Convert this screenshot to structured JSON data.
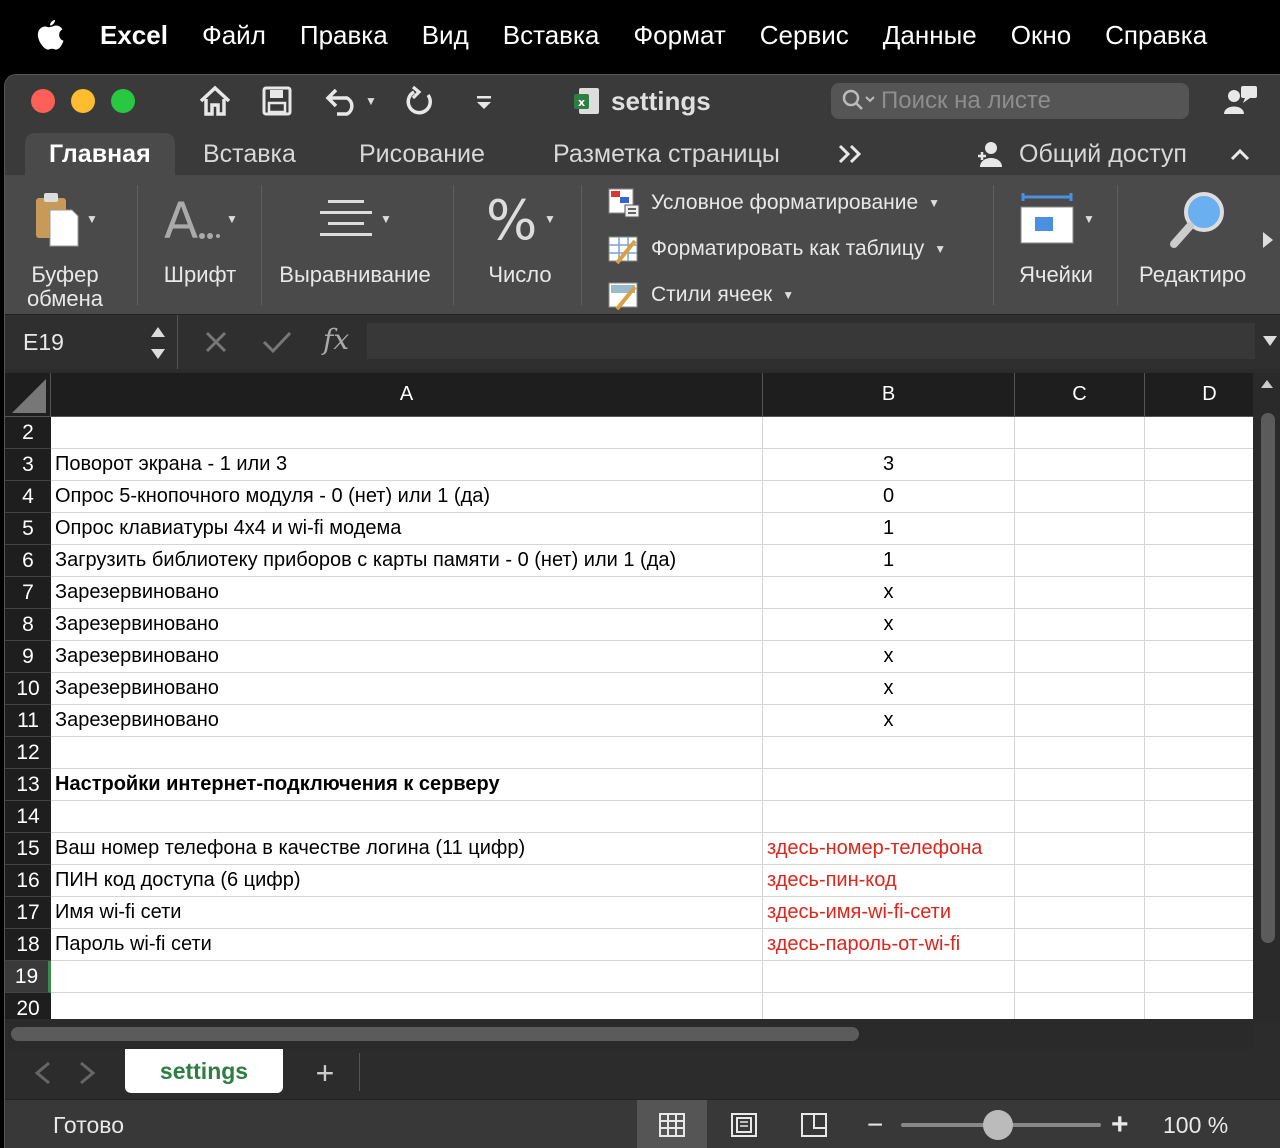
{
  "menubar": {
    "app": "Excel",
    "items": [
      "Файл",
      "Правка",
      "Вид",
      "Вставка",
      "Формат",
      "Сервис",
      "Данные",
      "Окно",
      "Справка"
    ]
  },
  "titlebar": {
    "doc_title": "settings",
    "search_placeholder": "Поиск на листе"
  },
  "ribbon_tabs": {
    "items": [
      "Главная",
      "Вставка",
      "Рисование",
      "Разметка страницы"
    ],
    "more": "»",
    "share": "Общий доступ"
  },
  "ribbon": {
    "clipboard_line1": "Буфер",
    "clipboard_line2": "обмена",
    "font": "Шрифт",
    "alignment": "Выравнивание",
    "number": "Число",
    "conditional_formatting": "Условное форматирование",
    "format_as_table": "Форматировать как таблицу",
    "cell_styles": "Стили ячеек",
    "cells": "Ячейки",
    "editing": "Редактиро"
  },
  "formula_bar": {
    "name_box": "E19",
    "fx": "fx",
    "value": ""
  },
  "grid": {
    "columns": [
      "A",
      "B",
      "C",
      "D"
    ],
    "rows": [
      {
        "num": "2",
        "a": "",
        "b": ""
      },
      {
        "num": "3",
        "a": "Поворот экрана - 1 или 3",
        "b": "3"
      },
      {
        "num": "4",
        "a": "Опрос 5-кнопочного модуля - 0 (нет) или 1 (да)",
        "b": "0"
      },
      {
        "num": "5",
        "a": "Опрос клавиатуры 4x4 и wi-fi модема",
        "b": "1"
      },
      {
        "num": "6",
        "a": "Загрузить библиотеку приборов с карты памяти - 0 (нет) или 1 (да)",
        "b": "1"
      },
      {
        "num": "7",
        "a": "Зарезервиновано",
        "b": "x"
      },
      {
        "num": "8",
        "a": "Зарезервиновано",
        "b": "x"
      },
      {
        "num": "9",
        "a": "Зарезервиновано",
        "b": "x"
      },
      {
        "num": "10",
        "a": "Зарезервиновано",
        "b": "x"
      },
      {
        "num": "11",
        "a": "Зарезервиновано",
        "b": "x"
      },
      {
        "num": "12",
        "a": "",
        "b": ""
      },
      {
        "num": "13",
        "a": "Настройки интернет-подключения к серверу",
        "b": ""
      },
      {
        "num": "14",
        "a": "",
        "b": ""
      },
      {
        "num": "15",
        "a": "Ваш номер телефона в качестве логина (11 цифр)",
        "b": "здесь-номер-телефона"
      },
      {
        "num": "16",
        "a": "ПИН код доступа (6 цифр)",
        "b": "здесь-пин-код"
      },
      {
        "num": "17",
        "a": "Имя wi-fi сети",
        "b": "здесь-имя-wi-fi-сети"
      },
      {
        "num": "18",
        "a": "Пароль wi-fi сети",
        "b": "здесь-пароль-от-wi-fi"
      },
      {
        "num": "19",
        "a": "",
        "b": ""
      },
      {
        "num": "20",
        "a": "",
        "b": ""
      }
    ],
    "selected_row": "19",
    "heading_row": "13",
    "red_value_color": "#e0251b"
  },
  "sheets": {
    "active": "settings",
    "add": "+"
  },
  "status": {
    "text": "Готово",
    "zoom": "100 %",
    "minus": "−",
    "plus": "+"
  },
  "colors": {
    "accent_green": "#2e7d42",
    "close": "#fe5f57",
    "minimize": "#febc2e",
    "zoom": "#28c840"
  }
}
